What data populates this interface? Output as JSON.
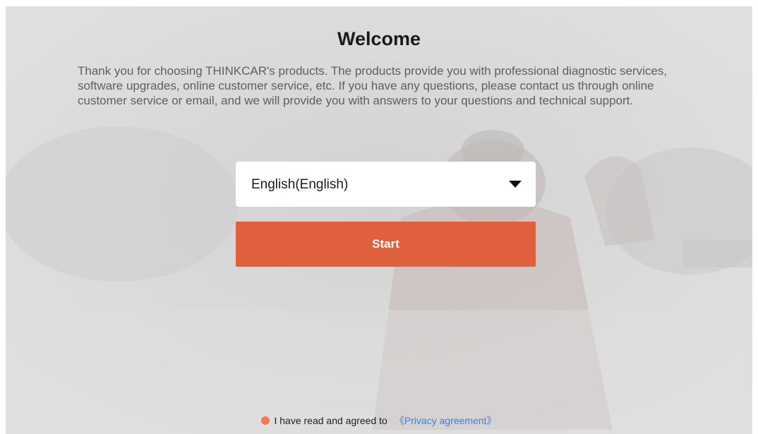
{
  "welcome": {
    "title": "Welcome",
    "description": "Thank you for choosing THINKCAR's products. The products provide you with professional diagnostic services, software upgrades, online customer service, etc. If you have any questions, please contact us through online customer service or email, and we will provide you with answers to your questions and technical support."
  },
  "language_select": {
    "selected": "English(English)",
    "icon": "chevron-down-icon"
  },
  "start_button": {
    "label": "Start"
  },
  "agreement": {
    "checked": true,
    "text": "I have read and agreed to",
    "link_text": "《Privacy agreement》"
  },
  "colors": {
    "accent": "#e0603e",
    "checkbox": "#ef7a5a",
    "link": "#4a7fc0",
    "background": "#dcdcdc"
  }
}
